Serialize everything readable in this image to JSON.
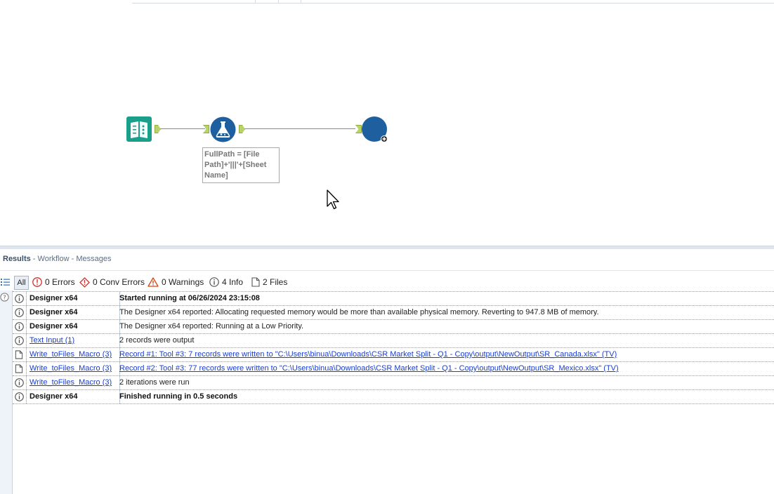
{
  "workflow": {
    "annotation": "FullPath = [File\nPath]+'|||'+[Sheet\nName]"
  },
  "results": {
    "title": "Results",
    "breadcrumb": " - Workflow - Messages",
    "filters": {
      "all_label": "All",
      "errors_label": "0 Errors",
      "conv_errors_label": "0 Conv Errors",
      "warnings_label": "0 Warnings",
      "info_label": "4 Info",
      "files_label": "2 Files"
    },
    "messages": [
      {
        "icon": "info-icon",
        "tool": "Designer x64",
        "tool_link": false,
        "text": "Started running at 06/26/2024 23:15:08",
        "bold": true,
        "text_link": false
      },
      {
        "icon": "info-icon",
        "tool": "Designer x64",
        "tool_link": false,
        "text": "The Designer x64 reported: Allocating requested memory would be more than available physical memory. Reverting to 947.8 MB of memory.",
        "bold": false,
        "text_link": false
      },
      {
        "icon": "info-icon",
        "tool": "Designer x64",
        "tool_link": false,
        "text": "The Designer x64 reported: Running at a Low Priority.",
        "bold": false,
        "text_link": false
      },
      {
        "icon": "info-icon",
        "tool": "Text Input (1)",
        "tool_link": true,
        "text": "2 records were output",
        "bold": false,
        "text_link": false
      },
      {
        "icon": "file-icon",
        "tool": "Write_toFiles_Macro (3)",
        "tool_link": true,
        "text": "Record #1: Tool #3: 7 records were written to \"C:\\Users\\binua\\Downloads\\CSR Market Split - Q1 - Copy\\output\\NewOutput\\SR_Canada.xlsx\" (TV)",
        "bold": false,
        "text_link": true
      },
      {
        "icon": "file-icon",
        "tool": "Write_toFiles_Macro (3)",
        "tool_link": true,
        "text": "Record #2: Tool #3: 77 records were written to \"C:\\Users\\binua\\Downloads\\CSR Market Split - Q1 - Copy\\output\\NewOutput\\SR_Mexico.xlsx\" (TV)",
        "bold": false,
        "text_link": true
      },
      {
        "icon": "info-icon",
        "tool": "Write_toFiles_Macro (3)",
        "tool_link": true,
        "text": "2 iterations were run",
        "bold": false,
        "text_link": false
      },
      {
        "icon": "info-icon",
        "tool": "Designer x64",
        "tool_link": false,
        "text": "Finished running in 0.5 seconds",
        "bold": true,
        "text_link": false
      }
    ]
  },
  "colors": {
    "text_input_tool": "#1aa08a",
    "formula_tool": "#1e5fa0",
    "macro_tool": "#1e5fa0",
    "error": "#d32f2f",
    "warning": "#d84315",
    "link": "#1a3fcc"
  }
}
